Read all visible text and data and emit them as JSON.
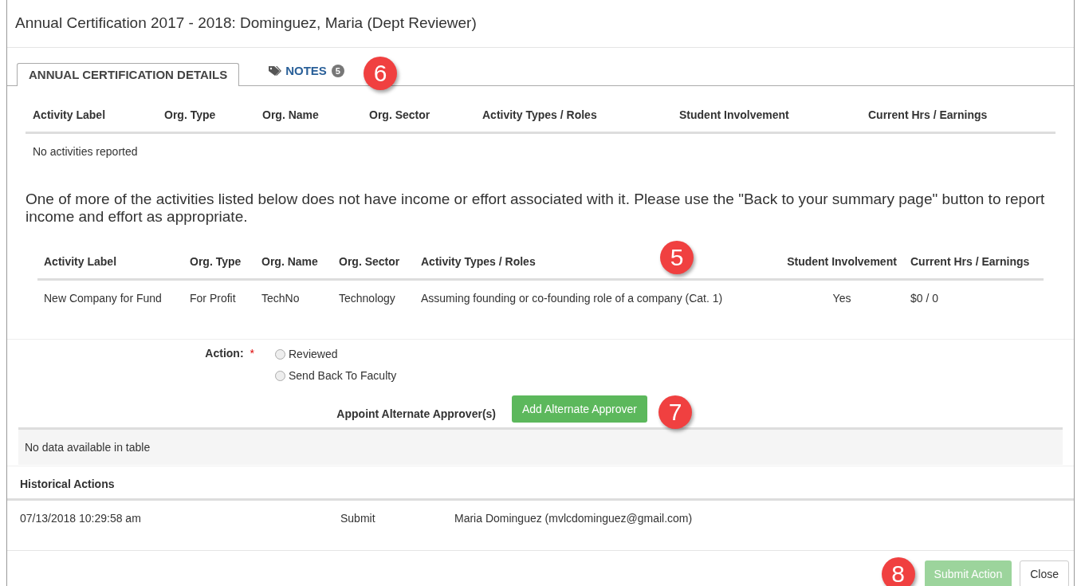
{
  "window": {
    "title": "Annual Certification 2017 - 2018: Dominguez, Maria (Dept Reviewer)"
  },
  "tabs": [
    {
      "label": "ANNUAL CERTIFICATION DETAILS",
      "selected": true
    },
    {
      "label": "NOTES",
      "selected": false,
      "count": "5",
      "callout": "6"
    }
  ],
  "activities_table": {
    "columns": [
      "Activity Label",
      "Org. Type",
      "Org. Name",
      "Org. Sector",
      "Activity Types / Roles",
      "Student Involvement",
      "Current Hrs / Earnings"
    ],
    "empty_message": "No activities reported"
  },
  "warning": "One of more of the activities listed below does not have income or effort associated with it. Please use the \"Back to your summary page\" button to report income and effort as appropriate.",
  "missing_table": {
    "columns": [
      "Activity Label",
      "Org. Type",
      "Org. Name",
      "Org. Sector",
      "Activity Types / Roles",
      "Student Involvement",
      "Current Hrs / Earnings"
    ],
    "callout": "5",
    "rows": [
      [
        "New Company for Fund",
        "For Profit",
        "TechNo",
        "Technology",
        "Assuming founding or co-founding role of a company (Cat. 1)",
        "Yes",
        "$0 / 0"
      ]
    ]
  },
  "action": {
    "label": "Action:",
    "required_mark": "*",
    "options": [
      {
        "label": "Reviewed",
        "selected": false
      },
      {
        "label": "Send Back To Faculty",
        "selected": false
      }
    ]
  },
  "alternate": {
    "label": "Appoint Alternate Approver(s)",
    "button": "Add Alternate Approver",
    "callout": "7",
    "empty_message": "No data available in table"
  },
  "history": {
    "title": "Historical Actions",
    "rows": [
      [
        "07/13/2018 10:29:58 am",
        "Submit",
        "Maria Dominguez (mvlcdominguez@gmail.com)"
      ]
    ]
  },
  "footer": {
    "callout": "8",
    "buttons": [
      {
        "label": "Submit Action",
        "kind": "primary",
        "disabled": true
      },
      {
        "label": "Close",
        "kind": "default",
        "disabled": false
      }
    ]
  }
}
